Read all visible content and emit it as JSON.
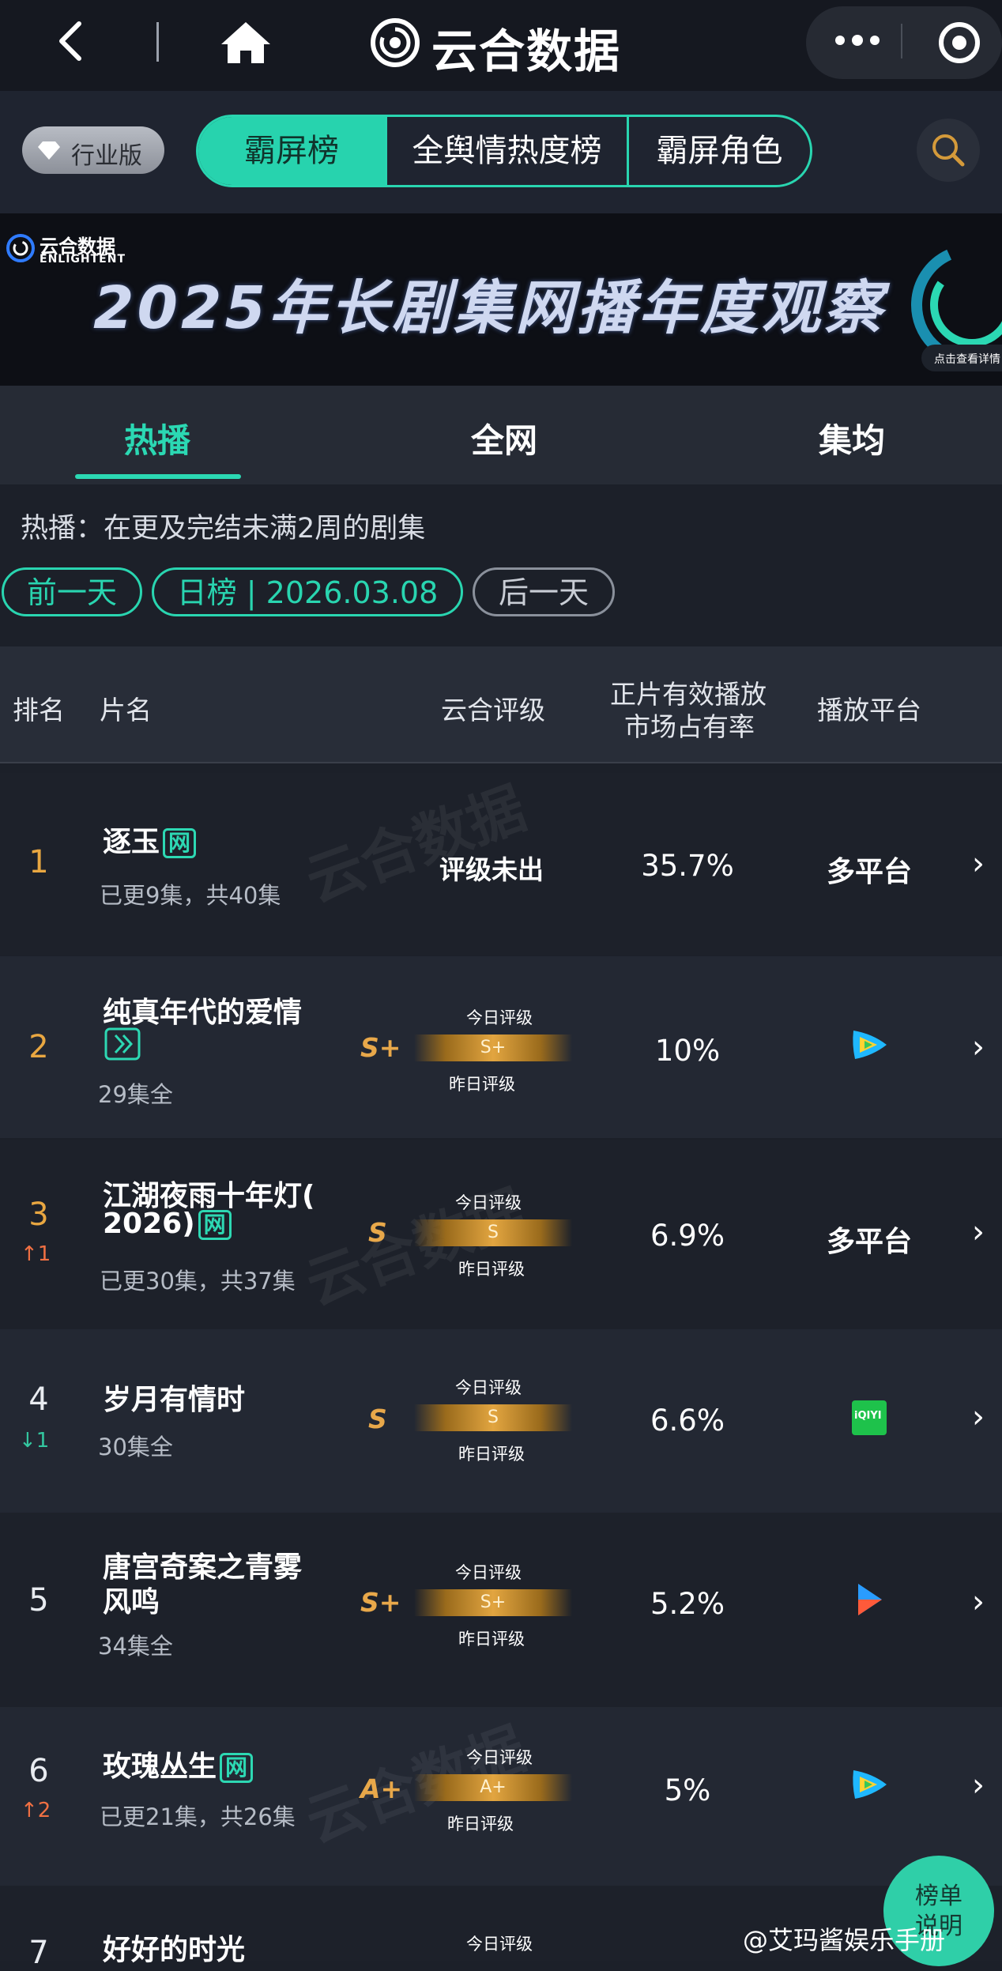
{
  "app": {
    "title": "云合数据"
  },
  "segments": {
    "industry": "行业版",
    "items": [
      "霸屏榜",
      "全舆情热度榜",
      "霸屏角色"
    ]
  },
  "banner": {
    "logo_cn": "云合数据",
    "logo_en": "ENLIGHTENT",
    "title": "2025年长剧集网播年度观察",
    "pill": "点击查看详情"
  },
  "tabs": [
    "热播",
    "全网",
    "集均"
  ],
  "description": "热播：在更及完结未满2周的剧集",
  "date_nav": {
    "prev": "前一天",
    "current": "日榜 | 2026.03.08",
    "next": "后一天"
  },
  "table": {
    "headers": {
      "rank": "排名",
      "name": "片名",
      "rating": "云合评级",
      "share_line1": "正片有效播放",
      "share_line2": "市场占有率",
      "platform": "播放平台"
    },
    "today_label": "今日评级",
    "yesterday_label": "昨日评级",
    "net_badge": "网",
    "rows": [
      {
        "rank": "1",
        "title": "逐玉",
        "sub": "已更9集，共40集",
        "rating": "评级未出",
        "share": "35.7%",
        "platform": "多平台"
      },
      {
        "rank": "2",
        "title": "纯真年代的爱情",
        "sub": "29集全",
        "grade_side": "S+",
        "grade_bar": "S+",
        "share": "10%",
        "platform_icon": "tencent-video-icon"
      },
      {
        "rank": "3",
        "change": "1",
        "change_dir": "up",
        "title_line1": "江湖夜雨十年灯(",
        "title_line2": "2026)",
        "sub": "已更30集，共37集",
        "grade_side": "S",
        "grade_bar": "S",
        "share": "6.9%",
        "platform": "多平台"
      },
      {
        "rank": "4",
        "change": "1",
        "change_dir": "down",
        "title": "岁月有情时",
        "sub": "30集全",
        "grade_side": "S",
        "grade_bar": "S",
        "share": "6.6%",
        "platform_icon": "iqiyi-icon",
        "platform_icon_text": "iQIYI"
      },
      {
        "rank": "5",
        "title_line1": "唐宫奇案之青雾",
        "title_line2": "风鸣",
        "sub": "34集全",
        "grade_side": "S+",
        "grade_bar": "S+",
        "share": "5.2%",
        "platform_icon": "youku-icon"
      },
      {
        "rank": "6",
        "change": "2",
        "change_dir": "up",
        "title": "玫瑰丛生",
        "sub": "已更21集，共26集",
        "grade_side": "A+",
        "grade_bar": "A+",
        "share": "5%",
        "platform_icon": "tencent-video-icon"
      },
      {
        "rank": "7",
        "title": "好好的时光"
      }
    ]
  },
  "fab": {
    "line1": "榜单",
    "line2": "说明"
  },
  "weibo": "@艾玛酱娱乐手册",
  "colors": {
    "accent": "#29d5b0",
    "gold": "#e9a741",
    "up": "#f07043",
    "down": "#33c7a0"
  }
}
